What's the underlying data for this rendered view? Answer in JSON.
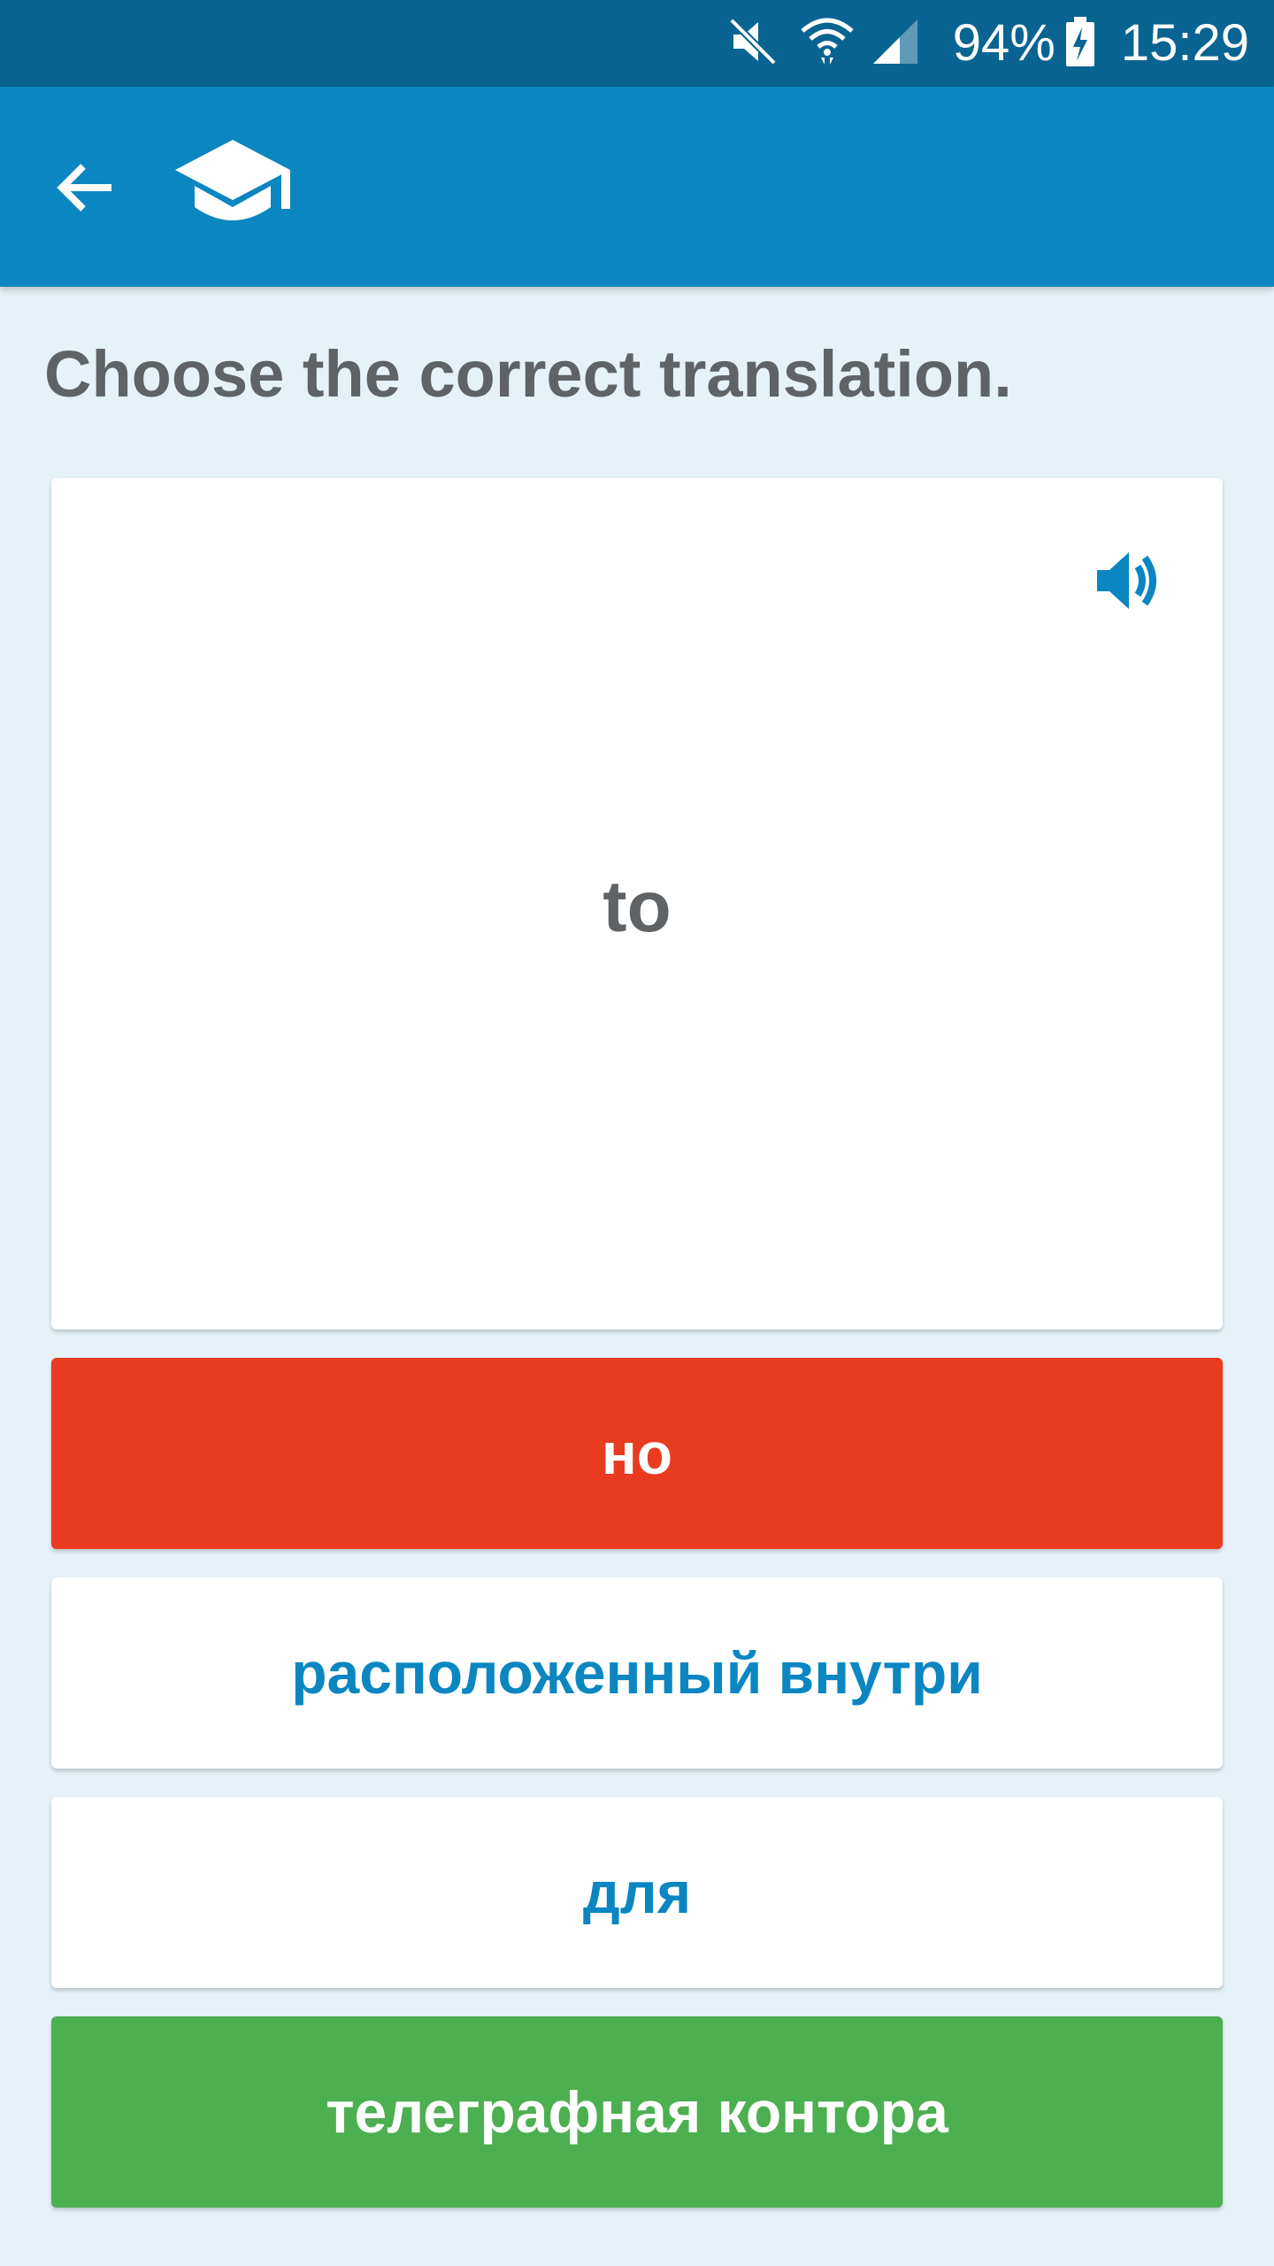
{
  "status_bar": {
    "battery": "94%",
    "time": "15:29",
    "icons": [
      "muted-speaker-icon",
      "wifi-icon",
      "signal-icon",
      "battery-charging-icon"
    ]
  },
  "app_bar": {
    "icons": [
      "back-arrow-icon",
      "graduation-cap-icon"
    ]
  },
  "quiz": {
    "prompt": "Choose the correct translation.",
    "word": "to",
    "speaker_icon": "speaker-volume-icon",
    "answers": [
      {
        "label": "но",
        "state": "wrong"
      },
      {
        "label": "расположенный внутри",
        "state": "neutral"
      },
      {
        "label": "для",
        "state": "neutral"
      },
      {
        "label": "телеграфная контора",
        "state": "correct"
      }
    ]
  },
  "colors": {
    "status_bar": "#0a6491",
    "app_bar": "#0b86c1",
    "background": "#e6f2f8",
    "wrong": "#e83b1f",
    "correct": "#4caf50",
    "accent_text": "#0b86c1",
    "gray_text": "#5f6366"
  }
}
